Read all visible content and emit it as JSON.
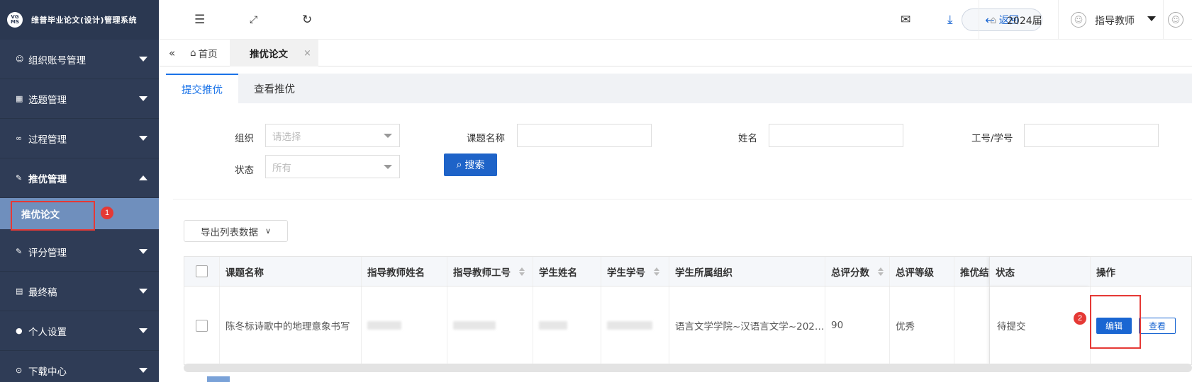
{
  "app": {
    "title": "维普毕业论文(设计)管理系统",
    "logo_text": "VG MS"
  },
  "sidebar": {
    "items": [
      {
        "label": "组织账号管理",
        "icon": "user-outline-icon"
      },
      {
        "label": "选题管理",
        "icon": "grid-icon"
      },
      {
        "label": "过程管理",
        "icon": "binoculars-icon"
      },
      {
        "label": "推优管理",
        "icon": "edit-icon",
        "expanded": true
      },
      {
        "label": "评分管理",
        "icon": "edit-icon"
      },
      {
        "label": "最终稿",
        "icon": "document-icon"
      },
      {
        "label": "个人设置",
        "icon": "user-icon"
      },
      {
        "label": "下载中心",
        "icon": "download-circle-icon"
      }
    ],
    "submenu_active": "推优论文"
  },
  "header": {
    "back_label": "返回",
    "year_label": "2024届",
    "user_role": "指导教师"
  },
  "tabs": {
    "home": "首页",
    "active": "推优论文",
    "close": "×"
  },
  "subtabs": [
    "提交推优",
    "查看推优"
  ],
  "filters": {
    "org_label": "组织",
    "org_placeholder": "请选择",
    "status_label": "状态",
    "status_value": "所有",
    "topic_label": "课题名称",
    "name_label": "姓名",
    "id_label": "工号/学号",
    "search_label": "搜索"
  },
  "export_label": "导出列表数据",
  "table": {
    "headers": [
      "课题名称",
      "指导教师姓名",
      "指导教师工号",
      "学生姓名",
      "学生学号",
      "学生所属组织",
      "总评分数",
      "总评等级",
      "推优结果",
      "状态",
      "操作"
    ],
    "row": {
      "topic": "陈冬标诗歌中的地理意象书写",
      "org": "语言文学学院~汉语言文学~202…",
      "score": "90",
      "grade": "优秀",
      "status": "待提交",
      "edit_label": "编辑",
      "view_label": "查看"
    }
  },
  "markers": [
    "1",
    "2"
  ],
  "colors": {
    "sidebar": "#2f3c56",
    "submenu_active": "#6f8fbd",
    "primary": "#1a66d2",
    "highlight": "#e53935"
  }
}
